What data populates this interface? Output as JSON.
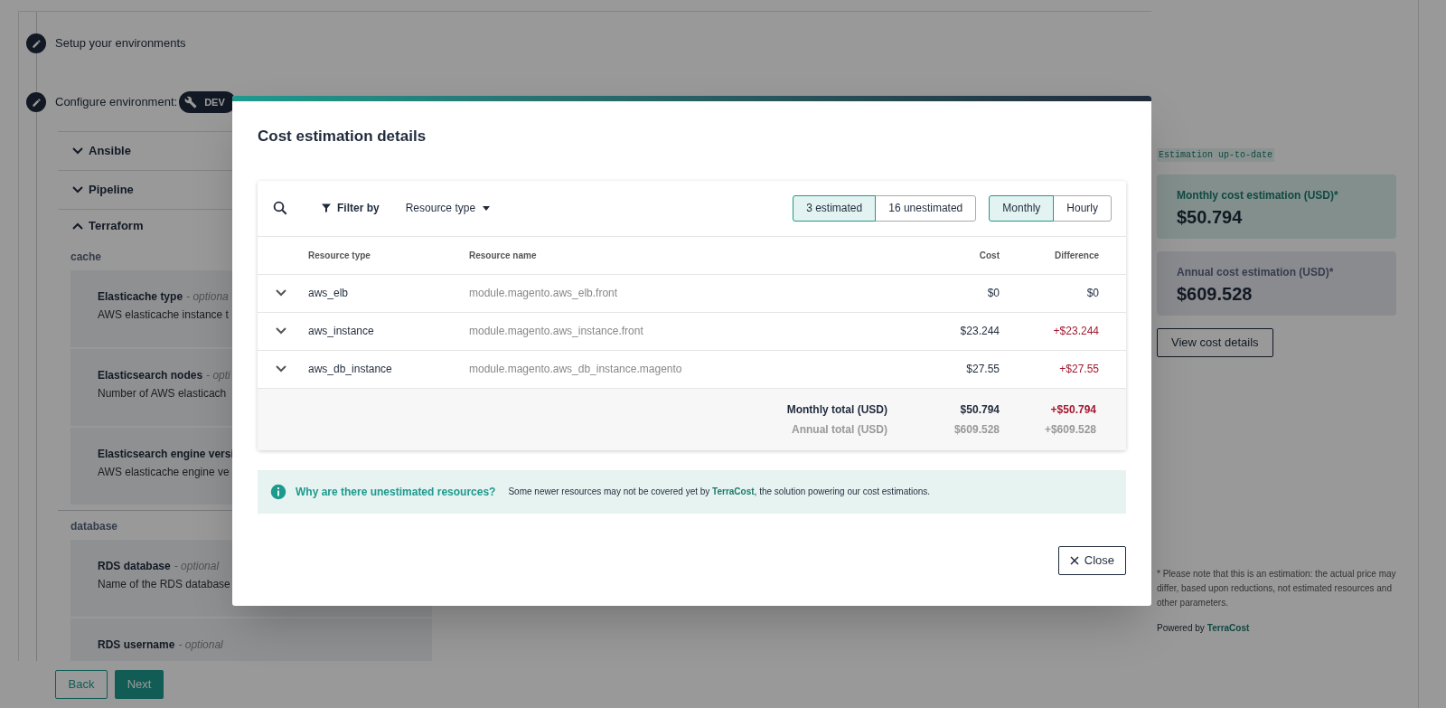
{
  "stepper": [
    {
      "label": "Setup your environments"
    },
    {
      "label": "Configure environment:",
      "badge": "DEV"
    }
  ],
  "accordions": [
    {
      "title": "Ansible",
      "expanded": false
    },
    {
      "title": "Pipeline",
      "expanded": false
    },
    {
      "title": "Terraform",
      "expanded": true
    }
  ],
  "sections": [
    {
      "title": "cache",
      "fields": [
        {
          "name": "Elasticache type",
          "note": "- optiona",
          "description": "AWS elasticache instance t"
        },
        {
          "name": "Elasticsearch nodes",
          "note": "- opti",
          "description": "Number of AWS elasticach"
        },
        {
          "name": "Elasticsearch engine versi",
          "description": "AWS elasticache engine ve"
        }
      ]
    },
    {
      "title": "database",
      "fields": [
        {
          "name": "RDS database",
          "note": "- optional",
          "description": "Name of the RDS database"
        },
        {
          "name": "RDS username",
          "note": "- optional"
        }
      ]
    }
  ],
  "nav_buttons": [
    {
      "label": "Back",
      "kind": "secondary"
    },
    {
      "label": "Next",
      "kind": "primary"
    }
  ],
  "estimate_panel": {
    "status": "Estimation up-to-date",
    "cards": [
      {
        "label": "Monthly cost estimation (USD)*",
        "value": "$50.794",
        "kind": "primary"
      },
      {
        "label": "Annual cost estimation (USD)*",
        "value": "$609.528",
        "kind": "secondary"
      }
    ],
    "button": "View cost details",
    "footnote": "* Please note that this is an estimation: the actual price may differ, based upon reductions, not estimated resources and other parameters.",
    "powered_by": "Powered by",
    "powered_link": "TerraCost"
  },
  "modal": {
    "title": "Cost estimation details",
    "filter_label": "Filter by",
    "dropdown": "Resource type",
    "estimate_toggle": [
      {
        "label": "3 estimated",
        "selected": true
      },
      {
        "label": "16 unestimated",
        "selected": false
      }
    ],
    "period_toggle": [
      {
        "label": "Monthly",
        "selected": true
      },
      {
        "label": "Hourly",
        "selected": false
      }
    ],
    "columns": [
      "Resource type",
      "Resource name",
      "Cost",
      "Difference"
    ],
    "rows": [
      {
        "type": "aws_elb",
        "name": "module.magento.aws_elb.front",
        "cost": "$0",
        "difference": "$0",
        "increase": false
      },
      {
        "type": "aws_instance",
        "name": "module.magento.aws_instance.front",
        "cost": "$23.244",
        "difference": "+$23.244",
        "increase": true
      },
      {
        "type": "aws_db_instance",
        "name": "module.magento.aws_db_instance.magento",
        "cost": "$27.55",
        "difference": "+$27.55",
        "increase": true
      }
    ],
    "totals": [
      {
        "label": "Monthly total (USD)",
        "cost": "$50.794",
        "difference": "+$50.794",
        "kind": "main"
      },
      {
        "label": "Annual total (USD)",
        "cost": "$609.528",
        "difference": "+$609.528",
        "kind": "muted"
      }
    ],
    "notice": {
      "title": "Why are there unestimated resources?",
      "text_before": "Some newer resources may not be covered yet by",
      "link": "TerraCost",
      "text_after": ", the solution powering our cost estimations."
    },
    "close": "Close"
  }
}
